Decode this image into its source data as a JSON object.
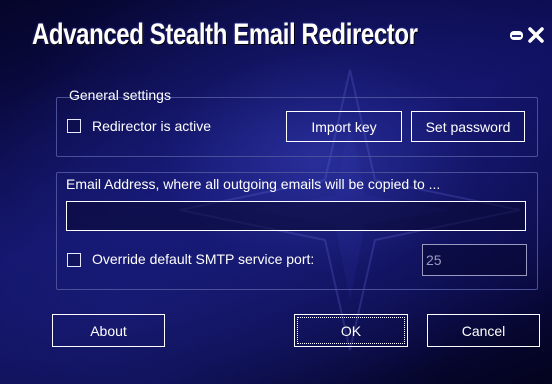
{
  "window": {
    "title": "Advanced Stealth Email Redirector",
    "controls": {
      "minimize_icon": "minimize-icon",
      "close_icon": "close-icon"
    }
  },
  "general": {
    "label": "General settings",
    "redirector_checkbox_label": "Redirector is active",
    "redirector_checked": false,
    "import_key_label": "Import key",
    "set_password_label": "Set password"
  },
  "email": {
    "label": "Email Address, where all outgoing emails will be copied to ...",
    "address_value": "",
    "override_checkbox_label": "Override default SMTP service port:",
    "override_checked": false,
    "port_value": "25"
  },
  "footer": {
    "about_label": "About",
    "ok_label": "OK",
    "cancel_label": "Cancel"
  },
  "colors": {
    "background": "#0b0b3a",
    "accent": "#2a30b0",
    "text": "#ffffff"
  }
}
